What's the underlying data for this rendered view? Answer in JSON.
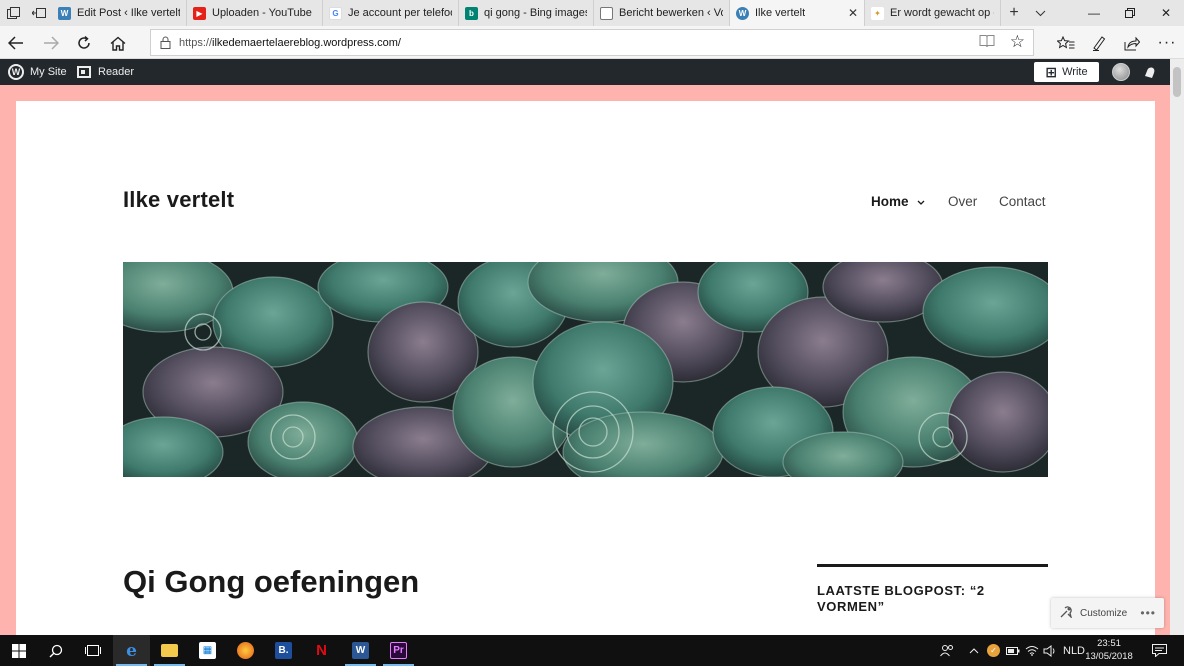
{
  "browser": {
    "tabs": [
      {
        "title": "Edit Post ‹ Ilke vertelt —",
        "icon": "wordpress-icon",
        "color": "#3a7fb5"
      },
      {
        "title": "Uploaden - YouTube",
        "icon": "youtube-icon",
        "color": "#e62117"
      },
      {
        "title": "Je account per telefoor",
        "icon": "google-icon",
        "color": "#4285f4"
      },
      {
        "title": "qi gong - Bing images",
        "icon": "bing-icon",
        "color": "#008373"
      },
      {
        "title": "Bericht bewerken ‹ Voe",
        "icon": "page-icon",
        "color": "#777777"
      },
      {
        "title": "Ilke vertelt",
        "icon": "wordpress-icon",
        "color": "#3a7fb5",
        "active": true
      },
      {
        "title": "Er wordt gewacht op ee",
        "icon": "loading-icon",
        "color": "#d29a2a"
      }
    ],
    "url_prefix": "https://",
    "url_host": "ilkedemaertelaereblog.wordpress.com/"
  },
  "wpbar": {
    "my_site": "My Site",
    "reader": "Reader",
    "write": "Write"
  },
  "site": {
    "title": "Ilke vertelt",
    "menu": {
      "home": "Home",
      "over": "Over",
      "contact": "Contact"
    }
  },
  "post": {
    "title": "Qi Gong oefeningen"
  },
  "widget": {
    "title": "LAATSTE BLOGPOST: “2 VORMEN”"
  },
  "customize": {
    "label": "Customize"
  },
  "taskbar": {
    "language": "NLD",
    "time": "23:51",
    "date": "13/05/2018"
  },
  "colors": {
    "page_background": "#ffb3ae",
    "wp_admin_bar": "#23282d",
    "taskbar": "#101010",
    "header_image_dominant": "#3f7a6c"
  }
}
